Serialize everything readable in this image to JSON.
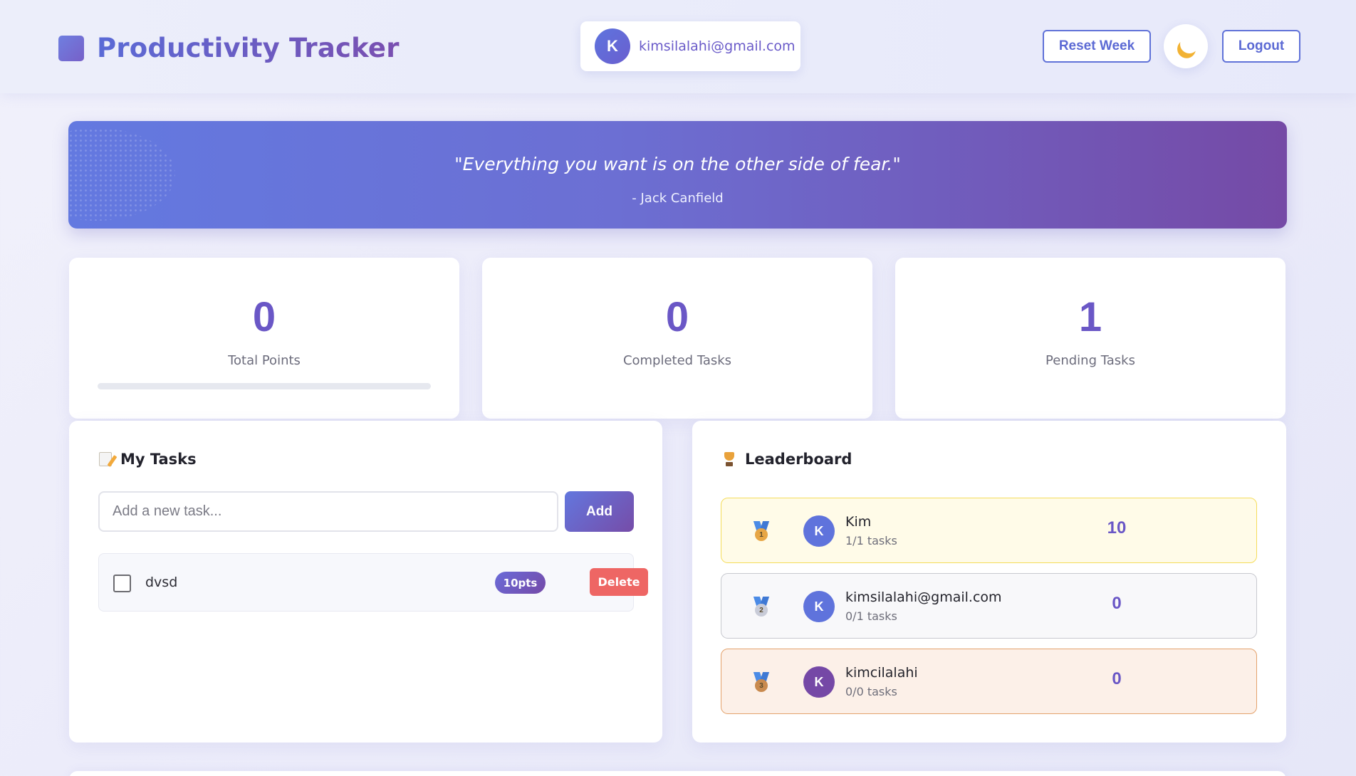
{
  "header": {
    "title": "Productivity Tracker",
    "user": {
      "initial": "K",
      "email": "kimsilalahi@gmail.com"
    },
    "reset_label": "Reset Week",
    "theme_icon": "moon-icon",
    "logout_label": "Logout"
  },
  "quote": {
    "text": "\"Everything you want is on the other side of fear.\"",
    "author": "- Jack Canfield"
  },
  "stats": [
    {
      "value": "0",
      "label": "Total Points",
      "progress": 0
    },
    {
      "value": "0",
      "label": "Completed Tasks"
    },
    {
      "value": "1",
      "label": "Pending Tasks"
    }
  ],
  "tasks": {
    "heading": "My Tasks",
    "input_placeholder": "Add a new task...",
    "add_label": "Add",
    "items": [
      {
        "name": "dvsd",
        "points": "10pts",
        "checked": false,
        "delete_label": "Delete"
      }
    ]
  },
  "leaderboard": {
    "heading": "Leaderboard",
    "rows": [
      {
        "rank": "1",
        "initial": "K",
        "name": "Kim",
        "tasks": "1/1 tasks",
        "score": "10",
        "medal_color": "#e7a645",
        "avatar_color": "#5f73dc"
      },
      {
        "rank": "2",
        "initial": "K",
        "name": "kimsilalahi@gmail.com",
        "tasks": "0/1 tasks",
        "score": "0",
        "medal_color": "#c9ccd8",
        "avatar_color": "#5f73dc"
      },
      {
        "rank": "3",
        "initial": "K",
        "name": "kimcilalahi",
        "tasks": "0/0 tasks",
        "score": "0",
        "medal_color": "#c98a4e",
        "avatar_color": "#7548a6"
      }
    ]
  }
}
